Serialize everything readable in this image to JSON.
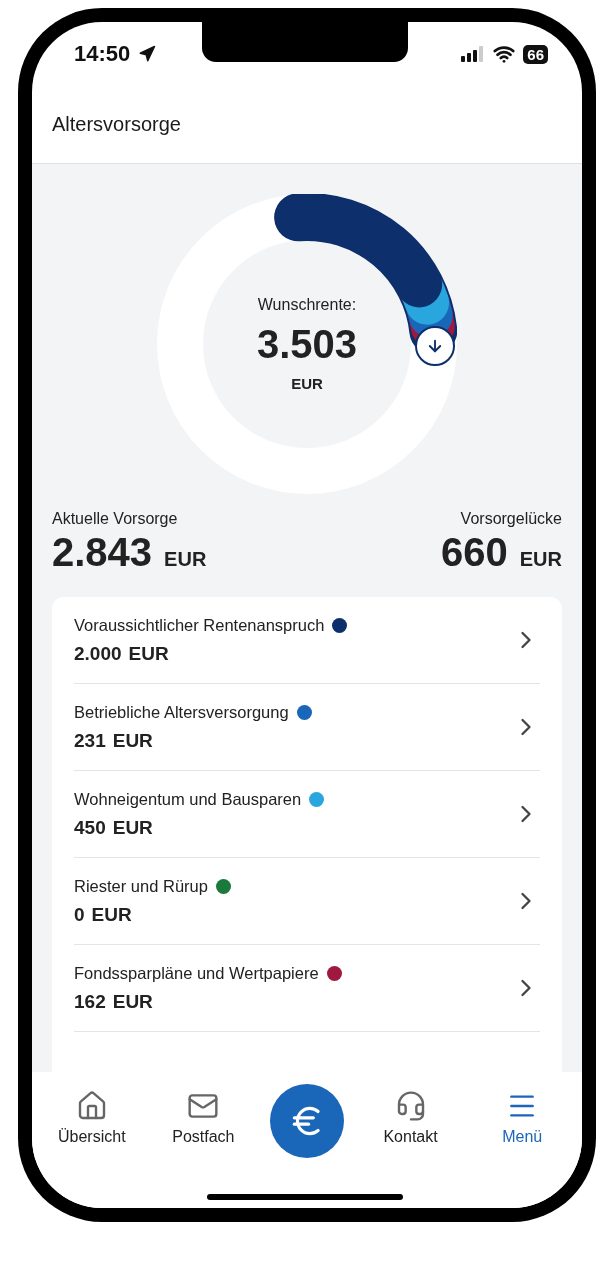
{
  "status_bar": {
    "time": "14:50",
    "battery": "66"
  },
  "header": {
    "title": "Altersvorsorge"
  },
  "gauge": {
    "label": "Wunschrente:",
    "value": "3.503",
    "unit": "EUR"
  },
  "summary": [
    {
      "label": "Aktuelle Vorsorge",
      "value": "2.843",
      "unit": "EUR"
    },
    {
      "label": "Vorsorgelücke",
      "value": "660",
      "unit": "EUR"
    }
  ],
  "items": [
    {
      "name": "Voraussichtlicher Rentenanspruch",
      "amount": "2.000",
      "unit": "EUR",
      "color": "#0d2f6b"
    },
    {
      "name": "Betriebliche Altersversorgung",
      "amount": "231",
      "unit": "EUR",
      "color": "#1a66b8"
    },
    {
      "name": "Wohneigentum und Bausparen",
      "amount": "450",
      "unit": "EUR",
      "color": "#29a6de"
    },
    {
      "name": "Riester und Rürup",
      "amount": "0",
      "unit": "EUR",
      "color": "#1b7a3b"
    },
    {
      "name": "Fondssparpläne und Wertpapiere",
      "amount": "162",
      "unit": "EUR",
      "color": "#a0173f"
    }
  ],
  "nav": [
    {
      "kind": "home",
      "label": "Übersicht",
      "selected": false
    },
    {
      "kind": "mail",
      "label": "Postfach",
      "selected": false
    },
    {
      "kind": "euro",
      "selected": false
    },
    {
      "kind": "contact",
      "label": "Kontakt",
      "selected": false
    },
    {
      "kind": "menu",
      "label": "Menü",
      "selected": true
    }
  ]
}
